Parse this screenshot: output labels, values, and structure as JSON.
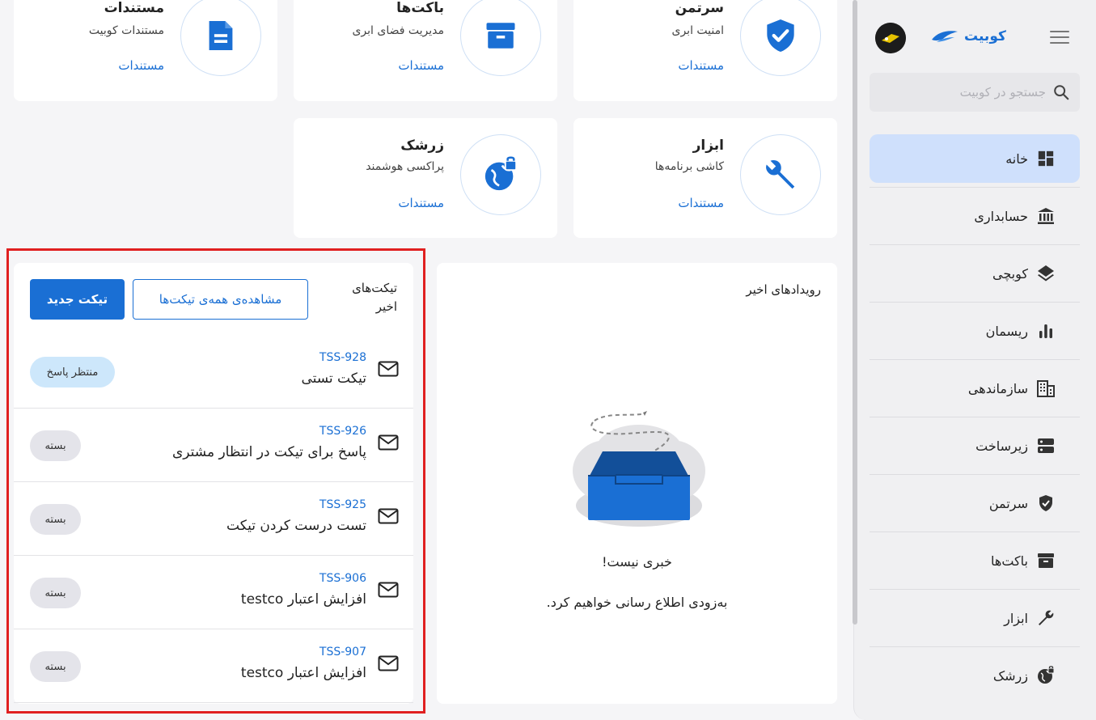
{
  "sidebar": {
    "brand": "کوبیت",
    "search_placeholder": "جستجو در کوبیت",
    "items": [
      {
        "label": "خانه",
        "icon": "dashboard-icon"
      },
      {
        "label": "حسابداری",
        "icon": "bank-icon"
      },
      {
        "label": "کوبچی",
        "icon": "layers-icon"
      },
      {
        "label": "ریسمان",
        "icon": "bar-chart-icon"
      },
      {
        "label": "سازماندهی",
        "icon": "building-icon"
      },
      {
        "label": "زیرساخت",
        "icon": "server-icon"
      },
      {
        "label": "سرتمن",
        "icon": "shield-icon"
      },
      {
        "label": "باکت‌ها",
        "icon": "archive-icon"
      },
      {
        "label": "ابزار",
        "icon": "wrench-icon"
      },
      {
        "label": "زرشک",
        "icon": "globe-lock-icon"
      }
    ]
  },
  "cards": [
    {
      "title": "سرتمن",
      "subtitle": "امنیت ابری",
      "link": "مستندات",
      "icon": "shield-check-icon"
    },
    {
      "title": "باکت‌ها",
      "subtitle": "مدیریت فضای ابری",
      "link": "مستندات",
      "icon": "archive-icon"
    },
    {
      "title": "مستندات",
      "subtitle": "مستندات کوبیت",
      "link": "مستندات",
      "icon": "document-icon"
    },
    {
      "title": "ابزار",
      "subtitle": "کاشی برنامه‌ها",
      "link": "مستندات",
      "icon": "wrench-icon"
    },
    {
      "title": "زرشک",
      "subtitle": "پراکسی هوشمند",
      "link": "مستندات",
      "icon": "globe-lock-icon"
    }
  ],
  "events": {
    "title": "رویدادهای اخیر",
    "empty_title": "خبری نیست!",
    "empty_subtitle": "به‌زودی اطلاع رسانی خواهیم کرد."
  },
  "tickets": {
    "title": "تیکت‌های اخیر",
    "view_all": "مشاهده‌ی همه‌ی تیکت‌ها",
    "new_ticket": "تیکت جدید",
    "items": [
      {
        "id": "TSS-928",
        "title": "تیکت تستی",
        "status": "منتظر پاسخ"
      },
      {
        "id": "TSS-926",
        "title": "پاسخ برای تیکت در انتظار مشتری",
        "status": "بسته"
      },
      {
        "id": "TSS-925",
        "title": "تست درست کردن تیکت",
        "status": "بسته"
      },
      {
        "id": "TSS-906",
        "title": "افزایش اعتبار testco",
        "status": "بسته"
      },
      {
        "id": "TSS-907",
        "title": "افزایش اعتبار testco",
        "status": "بسته"
      }
    ]
  },
  "colors": {
    "accent": "#1a6fd4",
    "highlight": "#e02020",
    "active_nav": "#cfe0fc"
  }
}
